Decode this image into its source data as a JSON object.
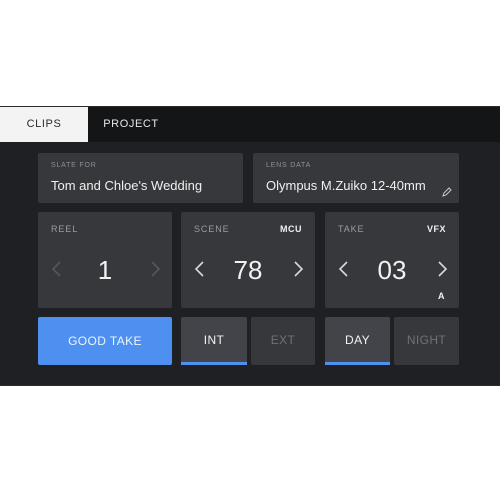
{
  "tabs": [
    {
      "label": "CLIPS",
      "active": true
    },
    {
      "label": "PROJECT",
      "active": false
    }
  ],
  "slate": {
    "label": "SLATE FOR",
    "value": "Tom and Chloe's Wedding"
  },
  "lens": {
    "label": "LENS DATA",
    "value": "Olympus M.Zuiko 12-40mm",
    "icon": "pencil-icon"
  },
  "reel": {
    "label": "REEL",
    "value": "1"
  },
  "scene": {
    "label": "SCENE",
    "tag": "MCU",
    "value": "78"
  },
  "take": {
    "label": "TAKE",
    "tag": "VFX",
    "value": "03",
    "sub": "A"
  },
  "buttons": {
    "good_take": "GOOD TAKE",
    "int": "INT",
    "ext": "EXT",
    "day": "DAY",
    "night": "NIGHT"
  },
  "colors": {
    "accent": "#4d90f0",
    "background": "#1f2023",
    "card": "#36383c",
    "tab_bar": "#141517"
  }
}
